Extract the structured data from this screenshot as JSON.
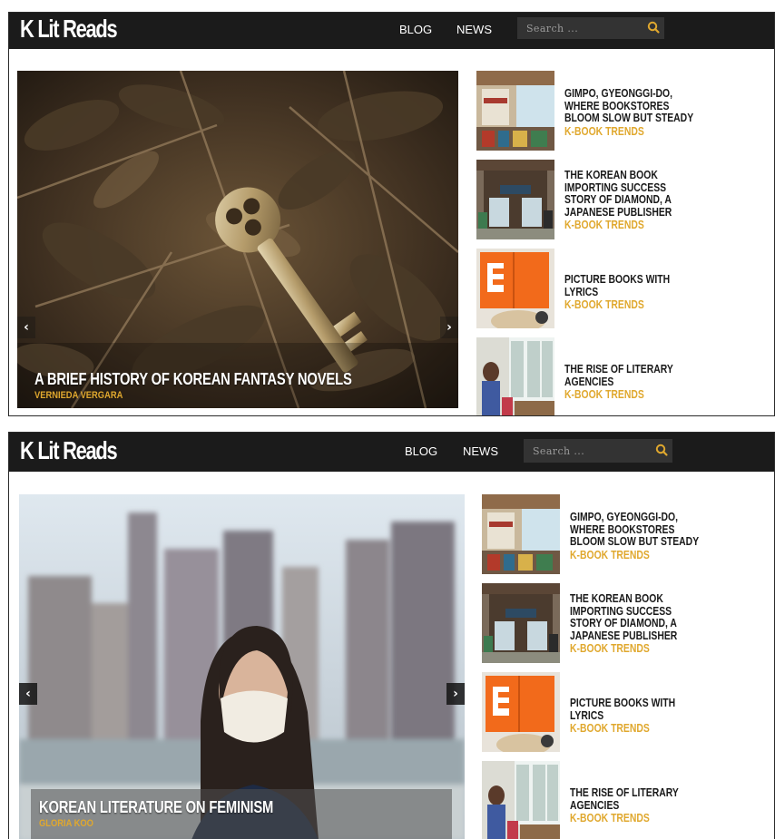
{
  "site": {
    "logo": "K Lit Reads",
    "nav": [
      "BLOG",
      "NEWS"
    ],
    "search_placeholder": "Search ...",
    "search_icon": "search-icon",
    "accent_color": "#e0a82e",
    "header_color": "#1b1b1b"
  },
  "captures": [
    {
      "slider": {
        "title": "A BRIEF HISTORY OF KOREAN FANTASY NOVELS",
        "author": "VERNIEDA VERGARA",
        "prev_icon": "chevron-left-icon",
        "next_icon": "chevron-right-icon"
      },
      "side_articles": [
        {
          "title": "GIMPO, GYEONGGI-DO, WHERE BOOKSTORES BLOOM SLOW BUT STEADY",
          "category": "K-BOOK TRENDS"
        },
        {
          "title": "THE KOREAN BOOK IMPORTING SUCCESS STORY OF DIAMOND, A JAPANESE PUBLISHER",
          "category": "K-BOOK TRENDS"
        },
        {
          "title": "PICTURE BOOKS WITH LYRICS",
          "category": "K-BOOK TRENDS"
        },
        {
          "title": "THE RISE OF LITERARY AGENCIES",
          "category": "K-BOOK TRENDS"
        }
      ]
    },
    {
      "slider": {
        "title": "KOREAN LITERATURE ON FEMINISM",
        "author": "GLORIA KOO",
        "prev_icon": "chevron-left-icon",
        "next_icon": "chevron-right-icon"
      },
      "side_articles": [
        {
          "title": "GIMPO, GYEONGGI-DO, WHERE BOOKSTORES BLOOM SLOW BUT STEADY",
          "category": "K-BOOK TRENDS"
        },
        {
          "title": "THE KOREAN BOOK IMPORTING SUCCESS STORY OF DIAMOND, A JAPANESE PUBLISHER",
          "category": "K-BOOK TRENDS"
        },
        {
          "title": "PICTURE BOOKS WITH LYRICS",
          "category": "K-BOOK TRENDS"
        },
        {
          "title": "THE RISE OF LITERARY AGENCIES",
          "category": "K-BOOK TRENDS"
        }
      ]
    }
  ]
}
